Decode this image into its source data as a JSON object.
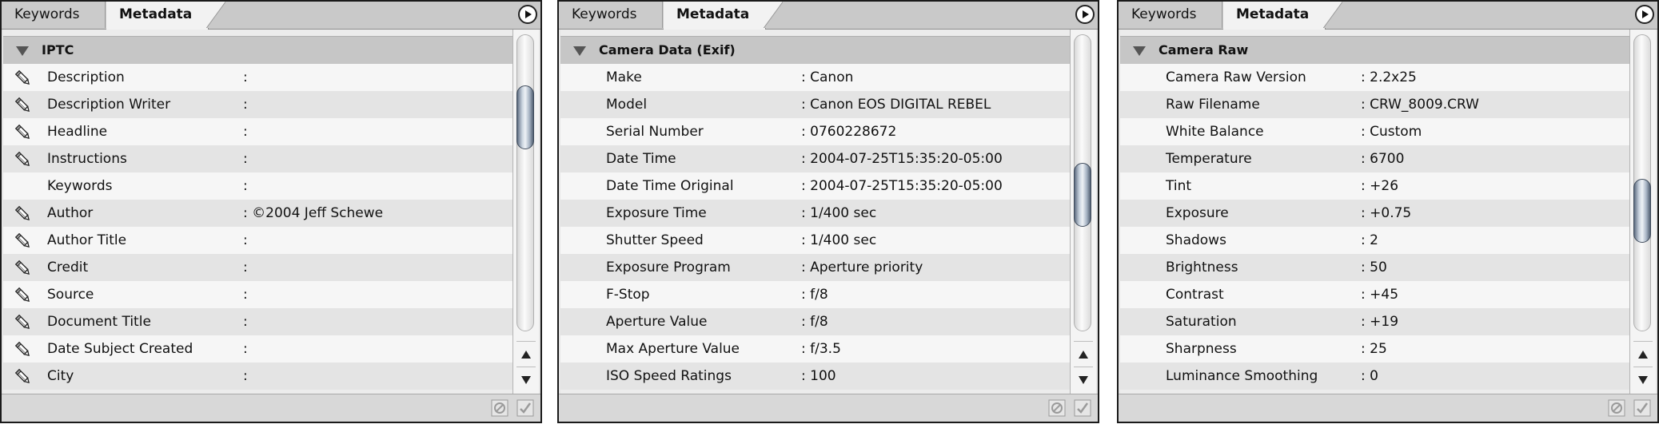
{
  "panels": [
    {
      "tabs": [
        "Keywords",
        "Metadata"
      ],
      "section": "IPTC",
      "rows": [
        {
          "label": "Description",
          "value": ":",
          "editable": true
        },
        {
          "label": "Description Writer",
          "value": ":",
          "editable": true
        },
        {
          "label": "Headline",
          "value": ":",
          "editable": true
        },
        {
          "label": "Instructions",
          "value": ":",
          "editable": true
        },
        {
          "label": "Keywords",
          "value": ":",
          "editable": false
        },
        {
          "label": "Author",
          "value": ": ©2004 Jeff Schewe",
          "editable": true
        },
        {
          "label": "Author Title",
          "value": ":",
          "editable": true
        },
        {
          "label": "Credit",
          "value": ":",
          "editable": true
        },
        {
          "label": "Source",
          "value": ":",
          "editable": true
        },
        {
          "label": "Document Title",
          "value": ":",
          "editable": true
        },
        {
          "label": "Date Subject Created",
          "value": ":",
          "editable": true
        },
        {
          "label": "City",
          "value": ":",
          "editable": true
        }
      ],
      "scroll_position": 0.22
    },
    {
      "tabs": [
        "Keywords",
        "Metadata"
      ],
      "section": "Camera Data (Exif)",
      "rows": [
        {
          "label": "Make",
          "value": ": Canon",
          "editable": false
        },
        {
          "label": "Model",
          "value": ": Canon EOS DIGITAL REBEL",
          "editable": false
        },
        {
          "label": "Serial Number",
          "value": ": 0760228672",
          "editable": false
        },
        {
          "label": "Date Time",
          "value": ": 2004-07-25T15:35:20-05:00",
          "editable": false
        },
        {
          "label": "Date Time Original",
          "value": ": 2004-07-25T15:35:20-05:00",
          "editable": false
        },
        {
          "label": "Exposure Time",
          "value": ": 1/400 sec",
          "editable": false
        },
        {
          "label": "Shutter Speed",
          "value": ": 1/400 sec",
          "editable": false
        },
        {
          "label": "Exposure Program",
          "value": ": Aperture priority",
          "editable": false
        },
        {
          "label": "F-Stop",
          "value": ": f/8",
          "editable": false
        },
        {
          "label": "Aperture Value",
          "value": ": f/8",
          "editable": false
        },
        {
          "label": "Max Aperture Value",
          "value": ": f/3.5",
          "editable": false
        },
        {
          "label": "ISO Speed Ratings",
          "value": ": 100",
          "editable": false
        }
      ],
      "scroll_position": 0.55
    },
    {
      "tabs": [
        "Keywords",
        "Metadata"
      ],
      "section": "Camera Raw",
      "rows": [
        {
          "label": "Camera Raw Version",
          "value": ": 2.2x25",
          "editable": false
        },
        {
          "label": "Raw Filename",
          "value": ": CRW_8009.CRW",
          "editable": false
        },
        {
          "label": "White Balance",
          "value": ": Custom",
          "editable": false
        },
        {
          "label": "Temperature",
          "value": ": 6700",
          "editable": false
        },
        {
          "label": "Tint",
          "value": ": +26",
          "editable": false
        },
        {
          "label": "Exposure",
          "value": ": +0.75",
          "editable": false
        },
        {
          "label": "Shadows",
          "value": ": 2",
          "editable": false
        },
        {
          "label": "Brightness",
          "value": ": 50",
          "editable": false
        },
        {
          "label": "Contrast",
          "value": ": +45",
          "editable": false
        },
        {
          "label": "Saturation",
          "value": ": +19",
          "editable": false
        },
        {
          "label": "Sharpness",
          "value": ": 25",
          "editable": false
        },
        {
          "label": "Luminance Smoothing",
          "value": ": 0",
          "editable": false
        }
      ],
      "scroll_position": 0.62
    }
  ]
}
